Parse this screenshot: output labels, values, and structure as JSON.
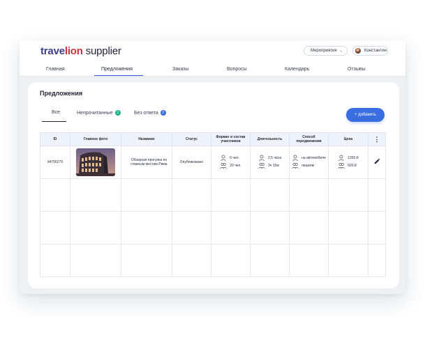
{
  "header": {
    "brand_part1": "trave",
    "brand_part2": "lion",
    "brand_part3": "supplier",
    "events_label": "Мероприятия",
    "user_name": "Константин"
  },
  "nav": {
    "tabs": [
      {
        "label": "Главная",
        "active": false
      },
      {
        "label": "Предложения",
        "active": true
      },
      {
        "label": "Заказы",
        "active": false
      },
      {
        "label": "Вопросы",
        "active": false
      },
      {
        "label": "Календарь",
        "active": false
      },
      {
        "label": "Отзывы",
        "active": false
      }
    ]
  },
  "page": {
    "title": "Предложения",
    "add_button": "+ добавить",
    "filters": [
      {
        "label": "Все",
        "count": null
      },
      {
        "label": "Непрочитанные",
        "count": "2"
      },
      {
        "label": "Без ответа",
        "count": "2"
      }
    ]
  },
  "table": {
    "columns": [
      "ID",
      "Главное фото",
      "Название",
      "Статус",
      "Формат и состав участников",
      "Длительность",
      "Способ передвижения",
      "Цена",
      "⋮"
    ],
    "rows": [
      {
        "id": "94756279",
        "name": "Обзорная прогулка по главным местам Рима",
        "status": "Опубликовано",
        "participants": [
          "6 чел.",
          "20 чел."
        ],
        "duration": [
          "2,5 часа",
          "3ч 15м"
        ],
        "transport": [
          "на автомобиле",
          "пешком"
        ],
        "price": [
          "1350 ₽",
          "500 ₽"
        ],
        "edit_icon": "pencil-icon"
      }
    ]
  },
  "colors": {
    "accent": "#3a6de0",
    "badge_green": "#1fae86",
    "header_bg": "#eef3fb"
  }
}
